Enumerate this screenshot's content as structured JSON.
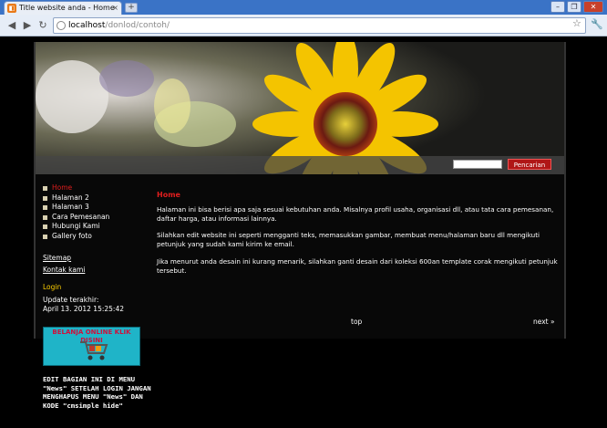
{
  "browser": {
    "tab_title": "Title website anda - Home",
    "tab_close": "×",
    "new_tab": "+",
    "url_host": "localhost",
    "url_path": "/donlod/contoh/",
    "window_buttons": [
      "–",
      "❐",
      "✕"
    ]
  },
  "colors": {
    "accent_red": "#b01616",
    "menu_active": "#e01e1e",
    "login": "#ffd000"
  },
  "search": {
    "button": "Pencarian",
    "value": ""
  },
  "menu": {
    "items": [
      {
        "label": "Home",
        "active": true
      },
      {
        "label": "Halaman 2"
      },
      {
        "label": "Halaman 3"
      },
      {
        "label": "Cara Pemesanan"
      },
      {
        "label": "Hubungi Kami"
      },
      {
        "label": "Gallery foto"
      }
    ]
  },
  "sidebar": {
    "sitemap": "Sitemap",
    "contact": "Kontak kami",
    "login": "Login",
    "update_label": "Update terakhir:",
    "update_date": "April 13. 2012 15:25:42"
  },
  "content": {
    "heading": "Home",
    "p1": "Halaman ini bisa berisi apa saja sesuai kebutuhan anda. Misalnya profil usaha, organisasi dll, atau tata cara pemesanan, daftar harga, atau informasi lainnya.",
    "p2": "Silahkan edit website ini seperti mengganti teks, memasukkan gambar, membuat menu/halaman baru dll mengikuti petunjuk yang sudah kami kirim ke email.",
    "p3": "Jika menurut anda desain ini kurang menarik, silahkan ganti desain dari koleksi 600an template corak mengikuti petunjuk tersebut."
  },
  "pager": {
    "top": "top",
    "next": "next »"
  },
  "ad": {
    "text": "BELANJA ONLINE KLIK DISINI"
  },
  "note": {
    "text": "EDIT BAGIAN INI DI MENU \"News\" SETELAH LOGIN JANGAN MENGHAPUS MENU \"News\" DAN KODE \"cmsimple hide\""
  }
}
